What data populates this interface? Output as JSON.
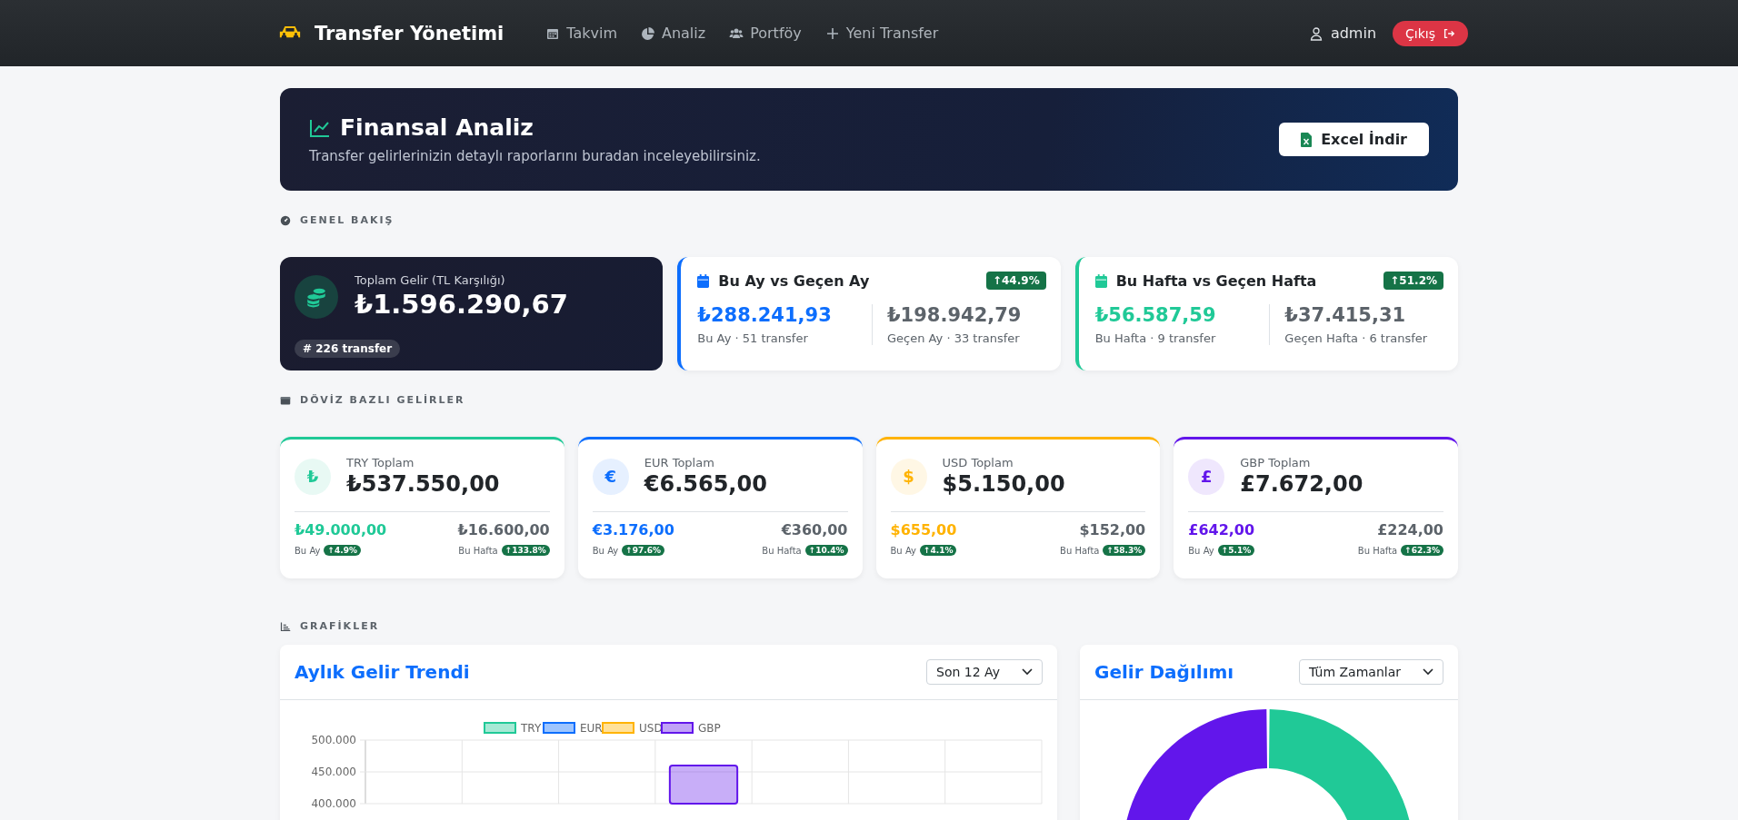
{
  "navbar": {
    "brand": "Transfer Yönetimi",
    "links": [
      {
        "label": "Takvim"
      },
      {
        "label": "Analiz"
      },
      {
        "label": "Portföy"
      },
      {
        "label": "Yeni Transfer"
      }
    ],
    "user": "admin",
    "logout": "Çıkış"
  },
  "hero": {
    "title": "Finansal Analiz",
    "subtitle": "Transfer gelirlerinizin detaylı raporlarını buradan inceleyebilirsiniz.",
    "button": "Excel İndir"
  },
  "overview": {
    "heading": "GENEL BAKIŞ",
    "total": {
      "label": "Toplam Gelir (TL Karşılığı)",
      "value": "₺1.596.290,67",
      "count": "# 226 transfer"
    },
    "comparisons": [
      {
        "title": "Bu Ay vs Geçen Ay",
        "color": "#0d6efd",
        "change": "↑44.9%",
        "current": {
          "value": "₺288.241,93",
          "caption": "Bu Ay · 51 transfer"
        },
        "previous": {
          "value": "₺198.942,79",
          "caption": "Geçen Ay · 33 transfer"
        }
      },
      {
        "title": "Bu Hafta vs Geçen Hafta",
        "color": "#20c997",
        "change": "↑51.2%",
        "current": {
          "value": "₺56.587,59",
          "caption": "Bu Hafta · 9 transfer"
        },
        "previous": {
          "value": "₺37.415,31",
          "caption": "Geçen Hafta · 6 transfer"
        }
      }
    ]
  },
  "currencies": {
    "heading": "DÖVİZ BAZLI GELİRLER",
    "items": [
      {
        "symbol": "₺",
        "label": "TRY Toplam",
        "total": "₺537.550,00",
        "color": "#20c997",
        "month": "₺49.000,00",
        "week": "₺16.600,00",
        "month_label": "Bu Ay",
        "month_change": "↑4.9%",
        "week_label": "Bu Hafta",
        "week_change": "↑133.8%"
      },
      {
        "symbol": "€",
        "label": "EUR Toplam",
        "total": "€6.565,00",
        "color": "#0d6efd",
        "month": "€3.176,00",
        "week": "€360,00",
        "month_label": "Bu Ay",
        "month_change": "↑97.6%",
        "week_label": "Bu Hafta",
        "week_change": "↑10.4%"
      },
      {
        "symbol": "$",
        "label": "USD Toplam",
        "total": "$5.150,00",
        "color": "#ffb302",
        "month": "$655,00",
        "week": "$152,00",
        "month_label": "Bu Ay",
        "month_change": "↑4.1%",
        "week_label": "Bu Hafta",
        "week_change": "↑58.3%"
      },
      {
        "symbol": "£",
        "label": "GBP Toplam",
        "total": "£7.672,00",
        "color": "#6216eb",
        "month": "£642,00",
        "week": "£224,00",
        "month_label": "Bu Ay",
        "month_change": "↑5.1%",
        "week_label": "Bu Hafta",
        "week_change": "↑62.3%"
      }
    ]
  },
  "charts": {
    "heading": "GRAFİKLER",
    "trend": {
      "title": "Aylık Gelir Trendi",
      "period": "Son 12 Ay",
      "chart_data": {
        "type": "bar",
        "yticks": [
          {
            "value": 400000,
            "label": "400.000"
          },
          {
            "value": 450000,
            "label": "450.000"
          },
          {
            "value": 500000,
            "label": "500.000"
          }
        ],
        "ylim": [
          400000,
          500000
        ],
        "series": [
          {
            "name": "TRY",
            "color": "#20c997",
            "values": [
              null,
              null,
              null,
              null,
              null,
              null,
              null
            ]
          },
          {
            "name": "EUR",
            "color": "#0d6efd",
            "values": [
              null,
              null,
              null,
              null,
              null,
              null,
              null
            ]
          },
          {
            "name": "USD",
            "color": "#ffb302",
            "values": [
              null,
              null,
              null,
              null,
              null,
              null,
              null
            ]
          },
          {
            "name": "GBP",
            "color": "#6216eb",
            "values": [
              null,
              null,
              null,
              460000,
              null,
              null,
              null
            ]
          }
        ]
      }
    },
    "distribution": {
      "title": "Gelir Dağılımı",
      "period": "Tüm Zamanlar"
    }
  }
}
